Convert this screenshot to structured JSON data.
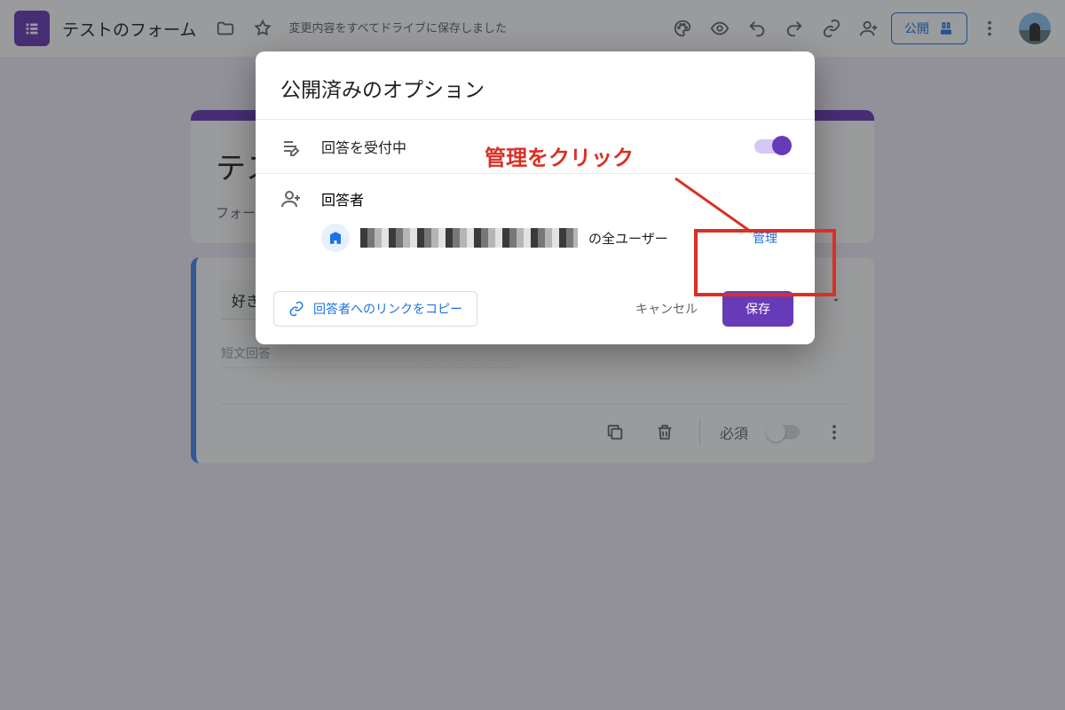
{
  "header": {
    "doc_title": "テストのフォーム",
    "save_status": "変更内容をすべてドライブに保存しました",
    "publish_label": "公開"
  },
  "form": {
    "title": "テスト",
    "description_placeholder": "フォームの説",
    "question_text": "好きな食べ",
    "answer_hint": "短文回答",
    "required_label": "必須"
  },
  "dialog": {
    "title": "公開済みのオプション",
    "accepting_label": "回答を受付中",
    "responders_label": "回答者",
    "org_suffix": "の全ユーザー",
    "manage_label": "管理",
    "copy_link_label": "回答者へのリンクをコピー",
    "cancel_label": "キャンセル",
    "save_label": "保存"
  },
  "annotation": {
    "text": "管理をクリック"
  }
}
